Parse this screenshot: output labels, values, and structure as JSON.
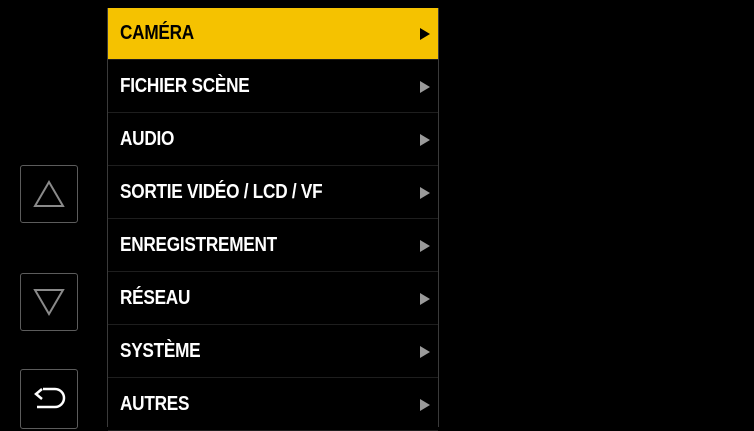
{
  "nav": {
    "up_icon": "triangle-up-icon",
    "down_icon": "triangle-down-icon",
    "back_icon": "return-arrow-icon"
  },
  "menu": {
    "accent_color": "#f5c200",
    "items": [
      {
        "label": "CAMÉRA",
        "selected": true
      },
      {
        "label": "FICHIER SCÈNE",
        "selected": false
      },
      {
        "label": "AUDIO",
        "selected": false
      },
      {
        "label": "SORTIE VIDÉO / LCD / VF",
        "selected": false
      },
      {
        "label": "ENREGISTREMENT",
        "selected": false
      },
      {
        "label": "RÉSEAU",
        "selected": false
      },
      {
        "label": "SYSTÈME",
        "selected": false
      },
      {
        "label": "AUTRES",
        "selected": false
      }
    ]
  }
}
